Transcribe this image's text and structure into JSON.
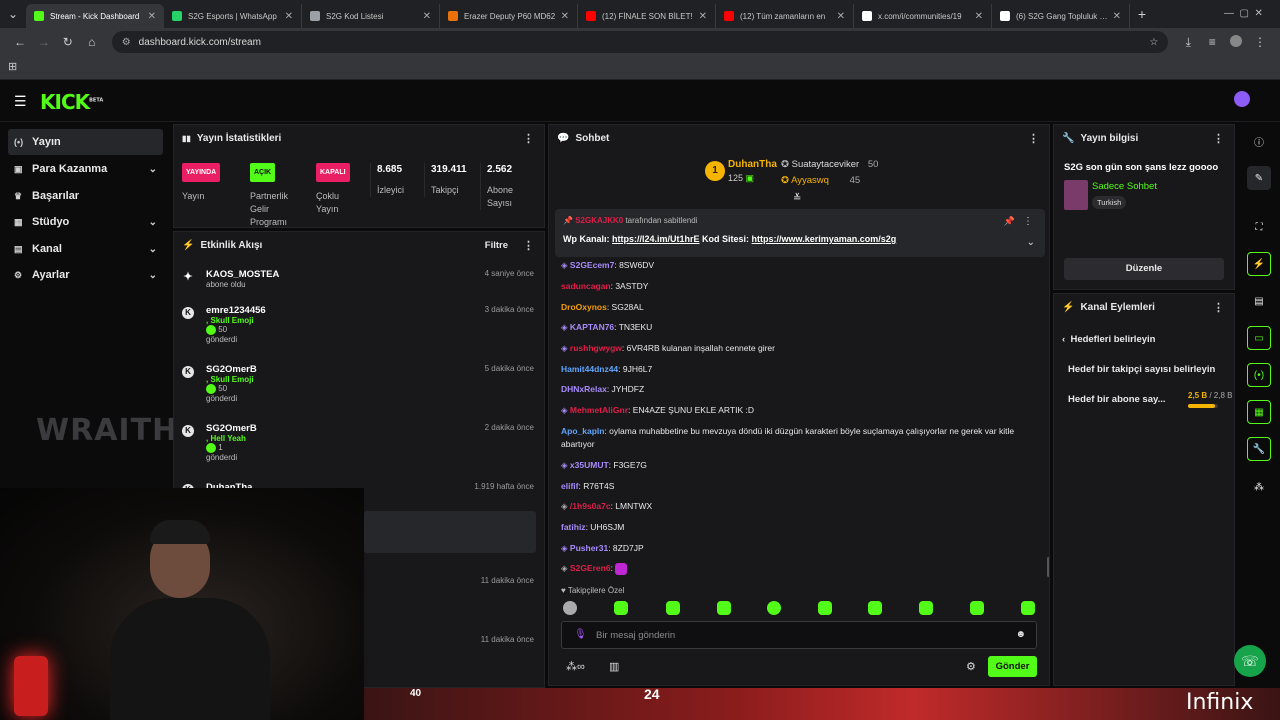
{
  "browser": {
    "tabs": [
      {
        "title": "Stream - Kick Dashboard",
        "fav": "#53fc18",
        "active": true
      },
      {
        "title": "S2G Esports | WhatsApp",
        "fav": "#25d366"
      },
      {
        "title": "S2G Kod Listesi",
        "fav": "#9aa0a6"
      },
      {
        "title": "Erazer Deputy P60 MD62",
        "fav": "#e8710a"
      },
      {
        "title": "(12) FİNALE SON BİLET!",
        "fav": "#ff0000"
      },
      {
        "title": "(12) Tüm zamanların en",
        "fav": "#ff0000"
      },
      {
        "title": "x.com/i/communities/19",
        "fav": "#ffffff"
      },
      {
        "title": "(6) S2G Gang Topluluk / X",
        "fav": "#ffffff"
      }
    ],
    "url": "dashboard.kick.com/stream"
  },
  "header": {
    "logo": "KICK",
    "beta": "BETA"
  },
  "sidebar": {
    "items": [
      {
        "label": "Yayın",
        "icon": "broadcast-icon"
      },
      {
        "label": "Para Kazanma",
        "icon": "money-icon"
      },
      {
        "label": "Başarılar",
        "icon": "trophy-icon"
      },
      {
        "label": "Stüdyo",
        "icon": "studio-icon"
      },
      {
        "label": "Kanal",
        "icon": "channel-icon"
      },
      {
        "label": "Ayarlar",
        "icon": "gear-icon"
      }
    ],
    "watermark": "WRAITH."
  },
  "stats": {
    "title": "Yayın İstatistikleri",
    "items": [
      {
        "badge": "YAYINDA",
        "label": "Yayın",
        "color": "#e91e63"
      },
      {
        "badge": "AÇIK",
        "label": "Partnerlik Gelir Programı",
        "color": "#53fc18"
      },
      {
        "badge": "KAPALI",
        "label": "Çoklu Yayın",
        "color": "#e91e63"
      },
      {
        "value": "8.685",
        "label": "İzleyici"
      },
      {
        "value": "319.411",
        "label": "Takipçi"
      },
      {
        "value": "2.562",
        "label": "Abone Sayısı"
      }
    ]
  },
  "activity": {
    "title": "Etkinlik Akışı",
    "filter": "Filtre",
    "events": [
      {
        "name": "KAOS_MOSTEA",
        "sub": "abone oldu",
        "time": "4 saniye önce"
      },
      {
        "name": "emre1234456",
        "gift": "Skull Emoji",
        "amount": "50",
        "sub": "gönderdi",
        "time": "3 dakika önce"
      },
      {
        "name": "SG2OmerB",
        "gift": "Skull Emoji",
        "amount": "50",
        "sub": "gönderdi",
        "time": "5 dakika önce"
      },
      {
        "name": "SG2OmerB",
        "gift": "Hell Yeah",
        "amount": "1",
        "sub": "gönderdi",
        "time": "2 dakika önce"
      },
      {
        "name": "DuhanTha",
        "time": "1.919 hafta önce"
      },
      {
        "time": "11 dakika önce"
      },
      {
        "time": "11 dakika önce"
      }
    ]
  },
  "chat": {
    "title": "Sohbet",
    "top": {
      "rank": "1",
      "name": "DuhanTha",
      "count": "125",
      "others": [
        {
          "name": "Suataytaceviker",
          "count": "50"
        },
        {
          "name": "Ayyaswq",
          "count": "45"
        }
      ]
    },
    "pinned": {
      "by": "tarafından sabitlendi",
      "text_prefix": "Wp Kanalı: ",
      "link1": "https://l24.im/Ut1hrE",
      "mid": " Kod Sitesi: ",
      "link2": "https://www.kerimyaman.com/s2g"
    },
    "messages": [
      {
        "user": "S2GEcem7",
        "text": ": 8SW6DV",
        "color": "#a78bfa"
      },
      {
        "user": "saduncagan",
        "text": ": 3ASTDY",
        "color": "#e11d48"
      },
      {
        "user": "DroOxynos",
        "text": ": SG28AL",
        "color": "#f59e0b"
      },
      {
        "user": "KAPTAN76",
        "text": ": TN3EKU",
        "color": "#a78bfa"
      },
      {
        "user": "rushhgwygw",
        "text": ": 6VR4RB kulanan inşallah cennete girer",
        "color": "#e11d48"
      },
      {
        "user": "Hamit44dnz44",
        "text": ": 9JH6L7",
        "color": "#60a5fa"
      },
      {
        "user": "DHNxRelax",
        "text": ": JYHDFZ",
        "color": "#a78bfa"
      },
      {
        "user": "MehmetAliGnr",
        "text": ": EN4AZE ŞUNU EKLE ARTIK :D",
        "color": "#e11d48"
      },
      {
        "user": "Apo_kapln",
        "text": ": oylama muhabbetine bu mevzuya döndü iki düzgün karakteri böyle suçlamaya çalışıyorlar ne gerek var kitle abartıyor",
        "color": "#60a5fa"
      },
      {
        "user": "x35UMUT",
        "text": ": F3GE7G",
        "color": "#a78bfa"
      },
      {
        "user": "elifif",
        "text": ": R76T4S",
        "color": "#a78bfa"
      },
      {
        "user": "/1h9s0a7c",
        "text": ": LMNTWX",
        "color": "#e11d48"
      },
      {
        "user": "fatihiz",
        "text": ": UH6SJM",
        "color": "#a78bfa"
      },
      {
        "user": "Pusher31",
        "text": ": 8ZD7JP",
        "color": "#a78bfa"
      },
      {
        "user": "S2GEren6",
        "text": ":",
        "color": "#e11d48"
      }
    ],
    "followers_only": "Takipçilere Özel",
    "placeholder": "Bir mesaj gönderin",
    "send": "Gönder"
  },
  "info": {
    "title": "Yayın bilgisi",
    "stream_title": "S2G son gün son şans lezz goooo",
    "category": "Sadece Sohbet",
    "tag": "Turkish",
    "edit": "Düzenle"
  },
  "actions": {
    "title": "Kanal Eylemleri",
    "back": "Hedefleri belirleyin",
    "goal1": "Hedef bir takipçi sayısı belirleyin",
    "goal2": "Hedef bir abone say...",
    "goal2_value": "2,5 B",
    "goal2_total": "/ 2,8 B",
    "goal2_progress": 0.89
  },
  "overlay": {
    "brand": "Infinix",
    "score": "40",
    "score2": "24"
  }
}
